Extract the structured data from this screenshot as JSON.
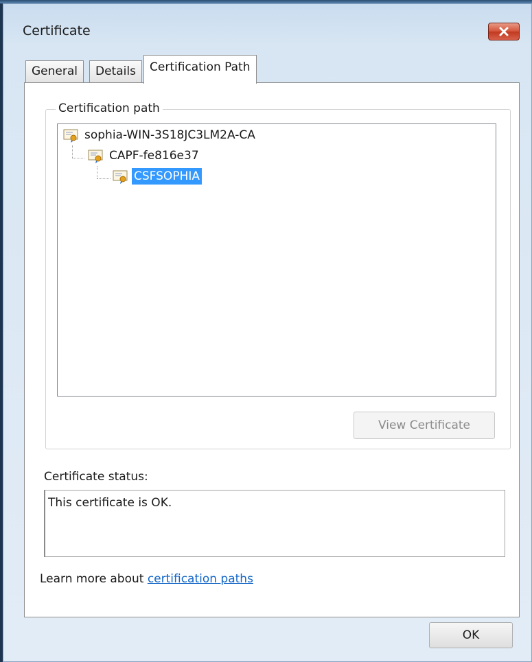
{
  "window": {
    "title": "Certificate",
    "close_icon": "close-icon"
  },
  "tabs": [
    {
      "label": "General",
      "active": false
    },
    {
      "label": "Details",
      "active": false
    },
    {
      "label": "Certification Path",
      "active": true
    }
  ],
  "certification_path": {
    "group_label": "Certification path",
    "items": [
      {
        "label": "sophia-WIN-3S18JC3LM2A-CA",
        "icon": "certificate-icon",
        "selected": false
      },
      {
        "label": "CAPF-fe816e37",
        "icon": "certificate-icon",
        "selected": false
      },
      {
        "label": "CSFSOPHIA",
        "icon": "certificate-icon",
        "selected": true
      }
    ],
    "view_button_label": "View Certificate"
  },
  "status": {
    "label": "Certificate status:",
    "text": "This certificate is OK."
  },
  "learn_more": {
    "prefix": "Learn more about ",
    "link_text": "certification paths"
  },
  "footer": {
    "ok_label": "OK"
  },
  "colors": {
    "selection": "#3399ff",
    "link": "#1467c8",
    "close_button": "#c8452b"
  }
}
